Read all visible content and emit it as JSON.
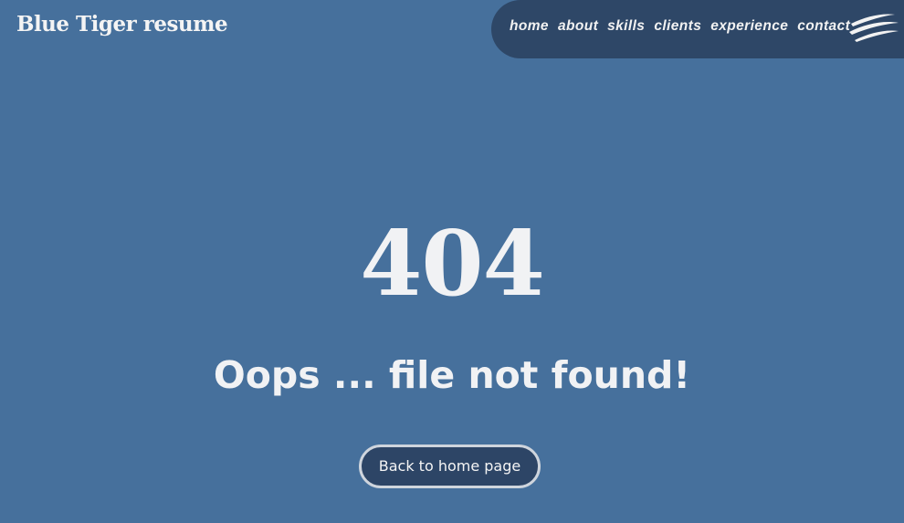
{
  "header": {
    "site_title": "Blue Tiger resume"
  },
  "nav": {
    "items": [
      {
        "label": "home"
      },
      {
        "label": "about"
      },
      {
        "label": "skills"
      },
      {
        "label": "clients"
      },
      {
        "label": "experience"
      },
      {
        "label": "contact"
      }
    ],
    "logo_icon": "tiger-claw-icon"
  },
  "main": {
    "error_code": "404",
    "message": "Oops ... file not found!",
    "back_button_label": "Back to home page"
  },
  "colors": {
    "background": "#46709c",
    "nav_background": "#2e4767",
    "button_background": "#2d4566",
    "button_border": "#cfd5dd",
    "text": "#f1f2f4"
  }
}
